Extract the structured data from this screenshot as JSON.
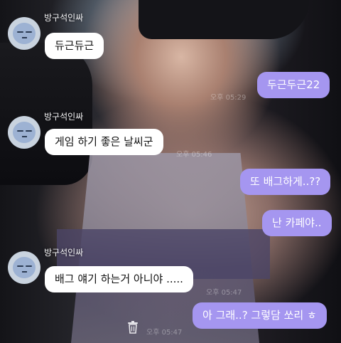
{
  "colors": {
    "incoming_bubble": "#ffffff",
    "outgoing_bubble": "#a596f0",
    "outgoing_text": "#ffffff",
    "incoming_text": "#111111"
  },
  "messages": [
    {
      "sender": "방구석인싸",
      "text": "듀근듀근"
    },
    {
      "text": "두근두근22",
      "time": "오후 05:29"
    },
    {
      "sender": "방구석인싸",
      "text": "게임 하기 좋은 날씨군",
      "time": "오후 05:46"
    },
    {
      "text": "또 배그하게..??"
    },
    {
      "text": "난 카페야.."
    },
    {
      "sender": "방구석인싸",
      "text": "배그 얘기 하는거 아니야 .....",
      "time": "오후 05:47"
    },
    {
      "text": "아 그래..? 그렇담 쏘리 ㅎ",
      "time": "오후 05:47"
    }
  ],
  "icons": {
    "avatar": "sleepy-face-avatar-icon",
    "trash": "trash-icon"
  }
}
